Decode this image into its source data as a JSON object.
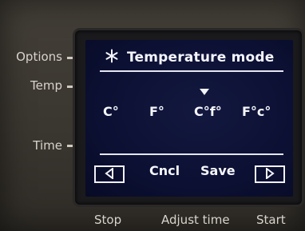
{
  "side_labels": {
    "options": "Options",
    "temp": "Temp",
    "time": "Time"
  },
  "bottom_labels": {
    "stop": "Stop",
    "adjust_time": "Adjust time",
    "start": "Start"
  },
  "screen": {
    "title_icon": "snowflake-icon",
    "title": "Temperature mode",
    "selected_index": 2,
    "options": [
      "C°",
      "F°",
      "C°f°",
      "F°c°"
    ],
    "buttons": {
      "left_icon": "arrow-left-icon",
      "cancel": "Cncl",
      "save": "Save",
      "right_icon": "arrow-right-icon"
    }
  },
  "colors": {
    "screen_background": "#0c1033",
    "screen_text": "#f4f4ff",
    "panel": "#3a3732"
  }
}
